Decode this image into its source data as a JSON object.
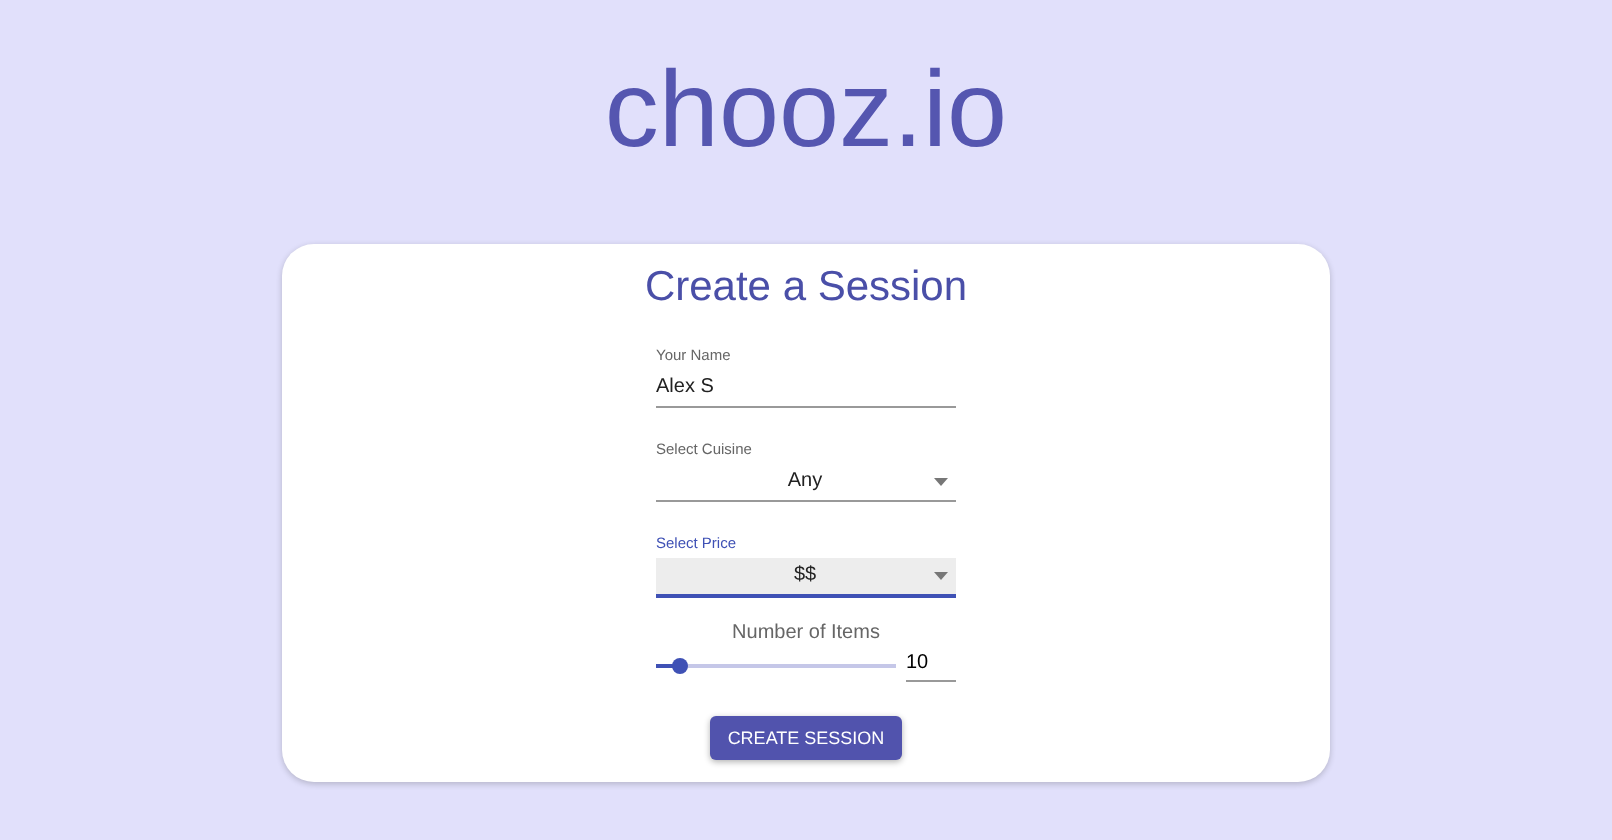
{
  "logo": "chooz.io",
  "card": {
    "title": "Create a Session",
    "fields": [
      {
        "kind": "text",
        "label": "Your Name",
        "value": "Alex S",
        "focused": false
      },
      {
        "kind": "select",
        "label": "Select Cuisine",
        "value": "Any",
        "focused": false
      },
      {
        "kind": "select",
        "label": "Select Price",
        "value": "$$",
        "focused": true
      }
    ],
    "slider": {
      "label": "Number of Items",
      "level": 0.1,
      "value": "10"
    },
    "button": "CREATE SESSION"
  }
}
